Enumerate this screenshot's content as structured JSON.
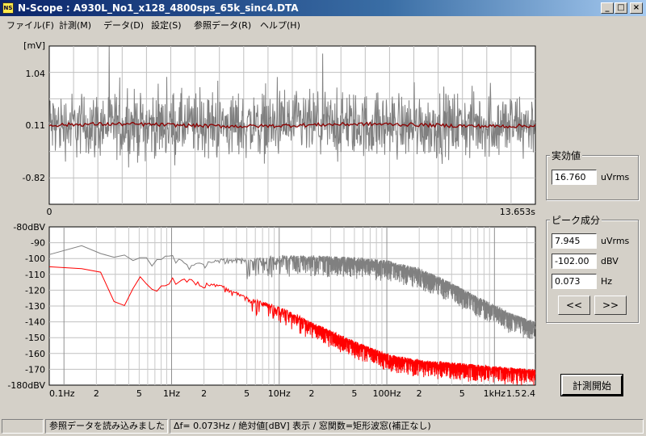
{
  "window": {
    "title": "N-Scope : A930L_No1_x128_4800sps_65k_sinc4.DTA",
    "icon_name": "app-icon",
    "icon_text": "NS",
    "minimize": "_",
    "maximize": "□",
    "close": "×"
  },
  "menu": [
    {
      "label": "ファイル(F)"
    },
    {
      "label": "計測(M)"
    },
    {
      "label": "データ(D)"
    },
    {
      "label": "設定(S)"
    },
    {
      "label": "参照データ(R)"
    },
    {
      "label": "ヘルプ(H)"
    }
  ],
  "chart_data": [
    {
      "type": "line",
      "title": "",
      "ylabel": "[mV]",
      "y_ticks": [
        "1.04",
        "0.11",
        "-0.82"
      ],
      "ylim": [
        -1.5,
        1.5
      ],
      "x_ticks": [
        "0",
        "13.653s"
      ],
      "xlim": [
        0,
        13.653
      ],
      "grid": true,
      "series": [
        {
          "color": "#808080",
          "noise_amplitude_mV": 0.9
        },
        {
          "color": "#8b0000",
          "level_mV": 0.0
        }
      ]
    },
    {
      "type": "line",
      "title": "",
      "ylabel": "",
      "y_ticks": [
        "-80dBV",
        "-90",
        "-100",
        "-110",
        "-120",
        "-130",
        "-140",
        "-150",
        "-160",
        "-170",
        "-180dBV"
      ],
      "ylim": [
        -180,
        -80
      ],
      "x_scale": "log",
      "x_ticks": [
        "0.1Hz",
        "2",
        "5",
        "1Hz",
        "2",
        "5",
        "10Hz",
        "2",
        "5",
        "100Hz",
        "2",
        "5",
        "1kHz",
        "1.5",
        "2.4"
      ],
      "xlim": [
        0.073,
        2400
      ],
      "grid": true,
      "series": [
        {
          "color": "#808080",
          "points": [
            [
              0.073,
              -97
            ],
            [
              0.1,
              -94
            ],
            [
              0.15,
              -91
            ],
            [
              0.2,
              -93
            ],
            [
              0.3,
              -97
            ],
            [
              0.5,
              -98
            ],
            [
              0.7,
              -101
            ],
            [
              1,
              -97
            ],
            [
              1.5,
              -104
            ],
            [
              2,
              -102
            ],
            [
              3,
              -100
            ],
            [
              5,
              -100
            ],
            [
              10,
              -98
            ],
            [
              20,
              -98
            ],
            [
              50,
              -99
            ],
            [
              100,
              -101
            ],
            [
              200,
              -106
            ],
            [
              400,
              -115
            ],
            [
              700,
              -124
            ],
            [
              1000,
              -129
            ],
            [
              1500,
              -135
            ],
            [
              2400,
              -140
            ]
          ]
        },
        {
          "color": "#ff0000",
          "points": [
            [
              0.073,
              -104
            ],
            [
              0.1,
              -105
            ],
            [
              0.15,
              -105
            ],
            [
              0.2,
              -104
            ],
            [
              0.25,
              -115
            ],
            [
              0.3,
              -128
            ],
            [
              0.35,
              -132
            ],
            [
              0.5,
              -111
            ],
            [
              0.7,
              -118
            ],
            [
              1,
              -112
            ],
            [
              1.5,
              -113
            ],
            [
              2,
              -115
            ],
            [
              3,
              -117
            ],
            [
              5,
              -124
            ],
            [
              10,
              -130
            ],
            [
              20,
              -140
            ],
            [
              50,
              -152
            ],
            [
              100,
              -160
            ],
            [
              200,
              -164
            ],
            [
              500,
              -166
            ],
            [
              1000,
              -168
            ],
            [
              2400,
              -170
            ]
          ]
        }
      ]
    }
  ],
  "rms_panel": {
    "title": "実効値",
    "value": "16.760",
    "unit": "uVrms"
  },
  "peak_panel": {
    "title": "ピーク成分",
    "value_v": "7.945",
    "unit_v": "uVrms",
    "value_db": "-102.00",
    "unit_db": "dBV",
    "value_hz": "0.073",
    "unit_hz": "Hz",
    "prev": "<<",
    "next": ">>"
  },
  "measure_button": "計測開始",
  "status": {
    "left": "",
    "message": "参照データを読み込みました",
    "info": "Δf= 0.073Hz / 絶対値[dBV] 表示 / 窓関数=矩形波窓(補正なし)"
  }
}
